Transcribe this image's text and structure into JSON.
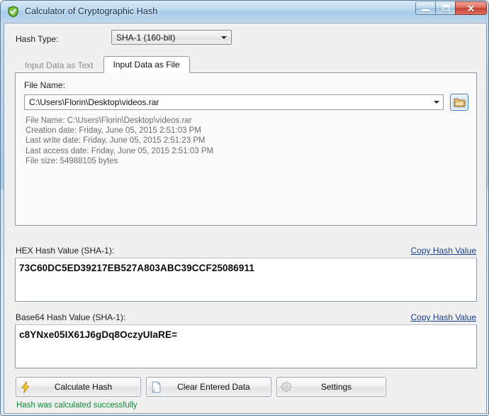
{
  "window": {
    "title": "Calculator of Cryptographic Hash",
    "icon": "shield-check-icon",
    "buttons": {
      "minimize": "minimize-icon",
      "maximize": "maximize-icon",
      "close": "✕"
    }
  },
  "hash_type": {
    "label": "Hash Type:",
    "selected": "SHA-1 (160-bit)"
  },
  "tabs": [
    {
      "label": "Input Data as Text",
      "active": false
    },
    {
      "label": "Input Data as File",
      "active": true
    }
  ],
  "file_panel": {
    "filename_label": "File Name:",
    "file_path": "C:\\Users\\Florin\\Desktop\\videos.rar",
    "browse_icon": "folder-icon",
    "info": "File Name: C:\\Users\\Florin\\Desktop\\videos.rar\nCreation date: Friday, June 05, 2015 2:51:03 PM\nLast write date: Friday, June 05, 2015 2:51:23 PM\nLast access date: Friday, June 05, 2015 2:51:03 PM\nFile size: 54988105 bytes"
  },
  "hex_section": {
    "label": "HEX Hash Value (SHA-1):",
    "copy_link": "Copy Hash Value",
    "value": "73C60DC5ED39217EB527A803ABC39CCF25086911"
  },
  "base64_section": {
    "label": "Base64 Hash Value (SHA-1):",
    "copy_link": "Copy Hash Value",
    "value": "c8YNxe05IX61J6gDq8OczyUIaRE="
  },
  "actions": {
    "calculate": "Calculate Hash",
    "clear": "Clear Entered Data",
    "settings": "Settings"
  },
  "status": "Hash was calculated successfully",
  "colors": {
    "accent": "#3c7fb1",
    "link": "#1b3f8f",
    "success": "#168a3a",
    "titlebar": "#a7cbe8"
  }
}
